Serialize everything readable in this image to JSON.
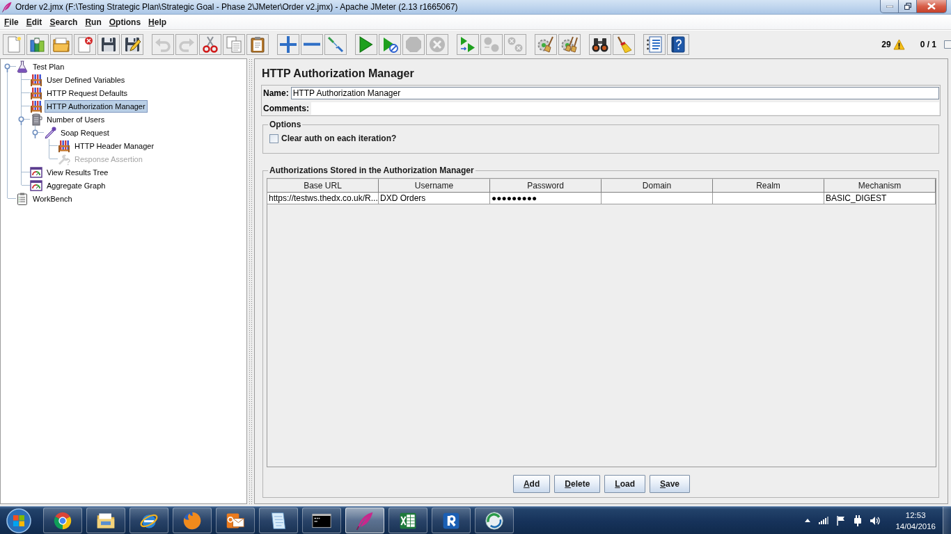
{
  "window": {
    "title": "Order v2.jmx (F:\\Testing Strategic Plan\\Strategic Goal - Phase 2\\JMeter\\Order v2.jmx) - Apache JMeter (2.13 r1665067)"
  },
  "menu": [
    "File",
    "Edit",
    "Search",
    "Run",
    "Options",
    "Help"
  ],
  "toolbar": {
    "groups": [
      {
        "buttons": [
          {
            "disabled": false
          },
          {
            "disabled": false
          },
          {
            "disabled": false
          },
          {
            "disabled": false
          },
          {
            "disabled": false
          },
          {
            "disabled": false
          }
        ]
      },
      {
        "buttons": [
          {
            "disabled": true
          },
          {
            "disabled": true
          },
          {
            "disabled": false
          },
          {
            "disabled": false
          },
          {
            "disabled": false
          }
        ]
      },
      {
        "buttons": [
          {
            "disabled": false
          },
          {
            "disabled": false
          },
          {
            "disabled": false
          }
        ]
      },
      {
        "buttons": [
          {
            "disabled": false
          },
          {
            "disabled": false
          },
          {
            "disabled": true
          },
          {
            "disabled": true
          }
        ]
      },
      {
        "buttons": [
          {
            "disabled": false
          },
          {
            "disabled": true
          },
          {
            "disabled": true
          }
        ]
      },
      {
        "buttons": [
          {
            "disabled": false
          },
          {
            "disabled": false
          }
        ]
      },
      {
        "buttons": [
          {
            "disabled": false
          },
          {
            "disabled": false
          }
        ]
      },
      {
        "buttons": [
          {
            "disabled": false
          },
          {
            "disabled": false
          }
        ]
      }
    ],
    "status": {
      "warnings": "29",
      "threads": "0 / 1"
    }
  },
  "tree": [
    {
      "label": "Test Plan",
      "kind": "plan",
      "selected": false,
      "disabled": false,
      "expanded": true,
      "children": [
        {
          "label": "User Defined Variables",
          "kind": "config",
          "selected": false,
          "disabled": false
        },
        {
          "label": "HTTP Request Defaults",
          "kind": "config",
          "selected": false,
          "disabled": false
        },
        {
          "label": "HTTP Authorization Manager",
          "kind": "config",
          "selected": true,
          "disabled": false
        },
        {
          "label": "Number of Users",
          "kind": "threads",
          "selected": false,
          "disabled": false,
          "expanded": true,
          "children": [
            {
              "label": "Soap Request",
              "kind": "sampler",
              "selected": false,
              "disabled": false,
              "expanded": true,
              "children": [
                {
                  "label": "HTTP Header Manager",
                  "kind": "config",
                  "selected": false,
                  "disabled": false
                },
                {
                  "label": "Response Assertion",
                  "kind": "assertion",
                  "selected": false,
                  "disabled": true
                }
              ]
            }
          ]
        },
        {
          "label": "View Results Tree",
          "kind": "listener",
          "selected": false,
          "disabled": false
        },
        {
          "label": "Aggregate Graph",
          "kind": "listener",
          "selected": false,
          "disabled": false
        }
      ]
    },
    {
      "label": "WorkBench",
      "kind": "workbench",
      "selected": false,
      "disabled": false
    }
  ],
  "editor": {
    "title": "HTTP Authorization Manager",
    "name": {
      "label": "Name:",
      "value": "HTTP Authorization Manager"
    },
    "comments": {
      "label": "Comments:"
    },
    "options": {
      "title": "Options",
      "clear_auth": {
        "label": "Clear auth on each iteration?",
        "checked": false
      }
    },
    "authorizations": {
      "title": "Authorizations Stored in the Authorization Manager",
      "columns": [
        "Base URL",
        "Username",
        "Password",
        "Domain",
        "Realm",
        "Mechanism"
      ],
      "rows": [
        {
          "base_url": "https://testws.thedx.co.uk/R...",
          "username": "DXD Orders",
          "password": "●●●●●●●●●",
          "mechanism": "BASIC_DIGEST"
        }
      ],
      "buttons": [
        "Add",
        "Delete",
        "Load",
        "Save"
      ]
    }
  },
  "taskbar": {
    "apps": [
      {
        "selected": false
      },
      {
        "selected": false
      },
      {
        "selected": false
      },
      {
        "selected": false
      },
      {
        "selected": false
      },
      {
        "selected": false
      },
      {
        "selected": false
      },
      {
        "selected": true
      },
      {
        "selected": false
      },
      {
        "selected": false
      },
      {
        "selected": false
      }
    ],
    "clock": {
      "time": "12:53",
      "date": "14/04/2016"
    }
  }
}
